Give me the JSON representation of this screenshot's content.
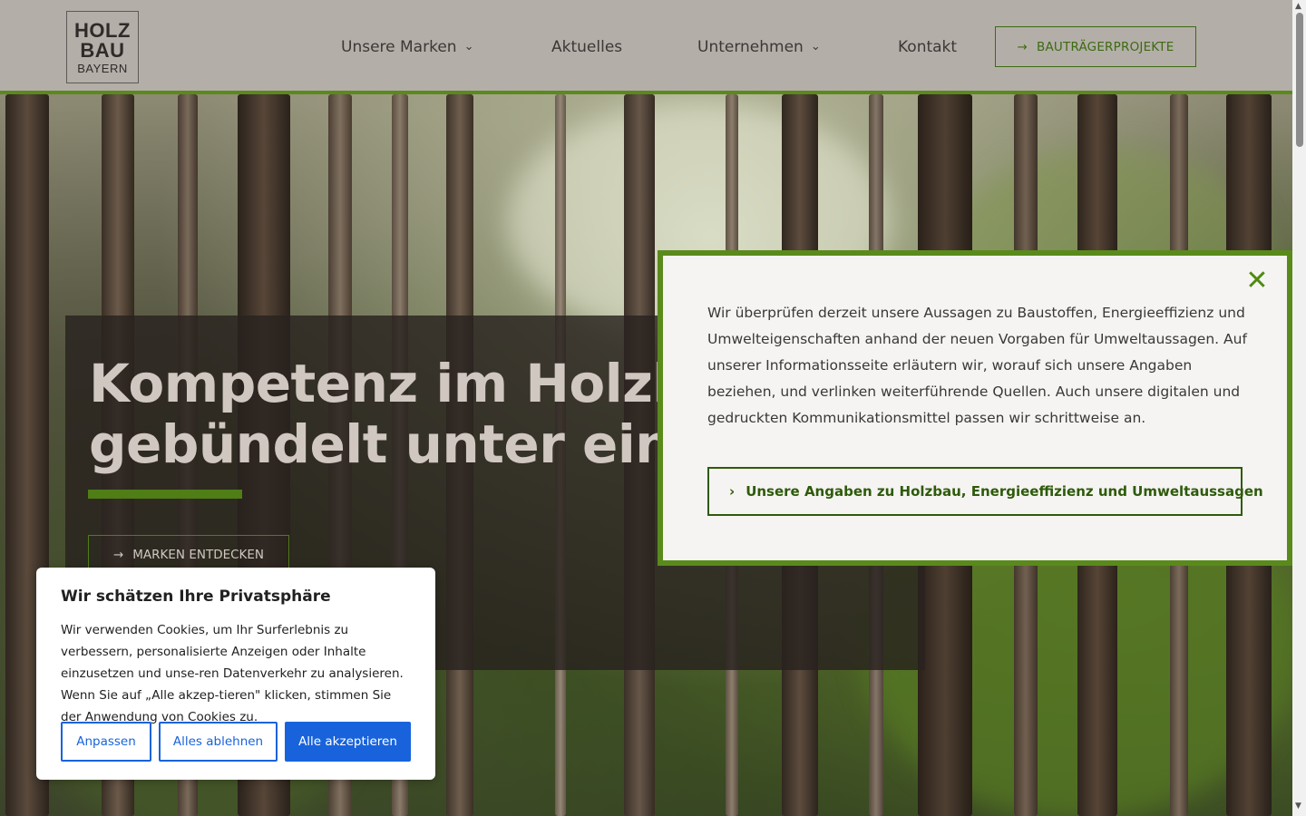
{
  "logo": {
    "line1": "HOLZ",
    "line2": "BAU",
    "line3": "BAYERN"
  },
  "nav": {
    "items": [
      {
        "label": "Unsere Marken",
        "has_dropdown": true
      },
      {
        "label": "Aktuelles",
        "has_dropdown": false
      },
      {
        "label": "Unternehmen",
        "has_dropdown": true
      },
      {
        "label": "Kontakt",
        "has_dropdown": false
      }
    ],
    "cta_label": "BAUTRÄGERPROJEKTE",
    "cta_icon": "arrow-right-icon"
  },
  "hero": {
    "title_line1": "Kompetenz im Holzbau",
    "title_line2": "gebündelt unter einem",
    "button_label": "MARKEN ENTDECKEN"
  },
  "notice": {
    "text": "Wir überprüfen derzeit unsere Aussagen zu Baustoffen, Energieeffizienz und Umwelteigenschaften anhand der neuen Vorgaben für Umweltaussagen. Auf unserer Informationsseite erläutern wir, worauf sich unsere Angaben beziehen, und verlinken weiterführende Quellen. Auch unsere digitalen und gedruckten Kommunikationsmittel passen wir schrittweise an.",
    "link_label": "Unsere Angaben zu Holzbau, Energieeffizienz und Umweltaussagen",
    "close_icon": "close-icon"
  },
  "cookie": {
    "title": "Wir schätzen Ihre Privatsphäre",
    "text": "Wir verwenden Cookies, um Ihr Surferlebnis zu verbessern, personalisierte Anzeigen oder Inhalte einzusetzen und unse-ren Datenverkehr zu analysieren. Wenn Sie auf „Alle akzep-tieren\" klicken, stimmen Sie der Anwendung von Cookies zu.",
    "buttons": {
      "customize": "Anpassen",
      "reject": "Alles ablehnen",
      "accept": "Alle akzeptieren"
    }
  },
  "colors": {
    "header_bg": "#b4aea8",
    "brand_green": "#5a8a1c",
    "dark_green": "#2e5a0a",
    "cookie_blue": "#1863dc"
  }
}
